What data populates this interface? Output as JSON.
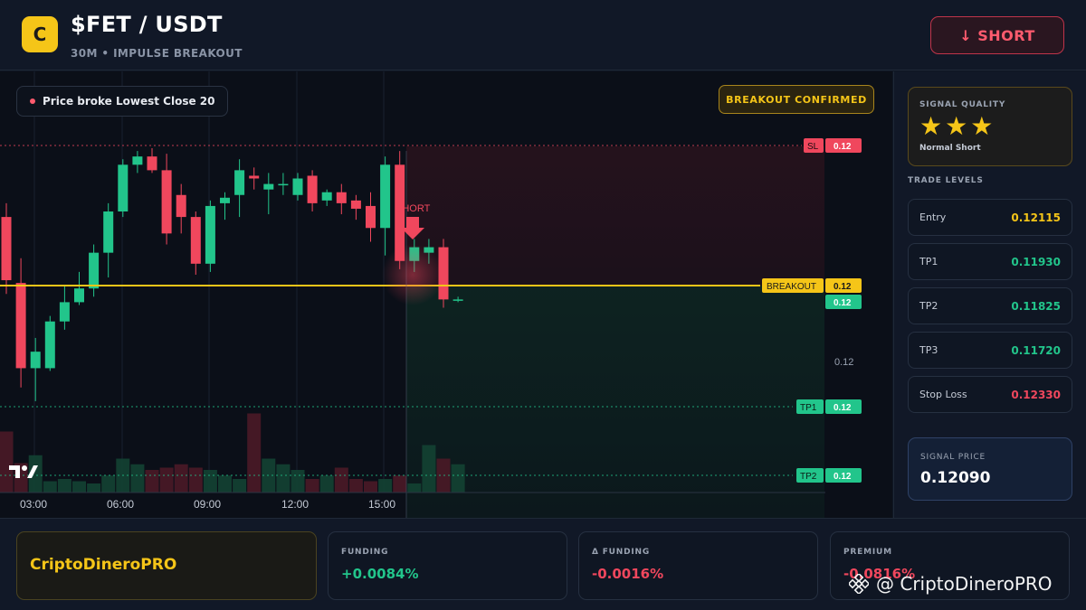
{
  "header": {
    "logo_letter": "C",
    "pair": "$FET / USDT",
    "subtitle": "30M • IMPULSE BREAKOUT",
    "action_label": "↓ SHORT"
  },
  "chart": {
    "info_text": "Price broke Lowest Close 20",
    "badge": "BREAKOUT CONFIRMED",
    "signal_label": "SHORT",
    "tv_logo": "TV",
    "colors": {
      "up": "#22c58b",
      "down": "#f0475d",
      "breakout": "#f5c518"
    }
  },
  "chart_data": {
    "type": "candlestick",
    "x_ticks": [
      "03:00",
      "06:00",
      "09:00",
      "12:00",
      "15:00"
    ],
    "price_ticks": [
      "0.12"
    ],
    "levels": [
      {
        "label": "SL",
        "value": "0.12"
      },
      {
        "label": "BREAKOUT",
        "value": "0.12"
      },
      {
        "label": "",
        "value": "0.12"
      },
      {
        "label": "TP1",
        "value": "0.12"
      },
      {
        "label": "TP2",
        "value": "0.12"
      }
    ],
    "candles": [
      {
        "o": 0.12148,
        "h": 0.12158,
        "l": 0.12092,
        "c": 0.12102
      },
      {
        "o": 0.121,
        "h": 0.12118,
        "l": 0.12024,
        "c": 0.12038
      },
      {
        "o": 0.12038,
        "h": 0.1206,
        "l": 0.12014,
        "c": 0.1205
      },
      {
        "o": 0.12038,
        "h": 0.12076,
        "l": 0.12036,
        "c": 0.12072
      },
      {
        "o": 0.12072,
        "h": 0.12098,
        "l": 0.12066,
        "c": 0.12086
      },
      {
        "o": 0.12086,
        "h": 0.12108,
        "l": 0.12084,
        "c": 0.12096
      },
      {
        "o": 0.12096,
        "h": 0.12128,
        "l": 0.1209,
        "c": 0.12122
      },
      {
        "o": 0.12122,
        "h": 0.12158,
        "l": 0.12104,
        "c": 0.12152
      },
      {
        "o": 0.12152,
        "h": 0.1219,
        "l": 0.12148,
        "c": 0.12186
      },
      {
        "o": 0.12186,
        "h": 0.12196,
        "l": 0.1218,
        "c": 0.12192
      },
      {
        "o": 0.12192,
        "h": 0.12198,
        "l": 0.1218,
        "c": 0.12182
      },
      {
        "o": 0.12182,
        "h": 0.12194,
        "l": 0.12128,
        "c": 0.12136
      },
      {
        "o": 0.12164,
        "h": 0.12172,
        "l": 0.12136,
        "c": 0.12148
      },
      {
        "o": 0.12148,
        "h": 0.12152,
        "l": 0.12106,
        "c": 0.12114
      },
      {
        "o": 0.12114,
        "h": 0.1216,
        "l": 0.12108,
        "c": 0.12156
      },
      {
        "o": 0.12158,
        "h": 0.12166,
        "l": 0.12146,
        "c": 0.12162
      },
      {
        "o": 0.12164,
        "h": 0.1219,
        "l": 0.12148,
        "c": 0.12182
      },
      {
        "o": 0.12178,
        "h": 0.12184,
        "l": 0.12168,
        "c": 0.12176
      },
      {
        "o": 0.12168,
        "h": 0.1218,
        "l": 0.1215,
        "c": 0.12172
      },
      {
        "o": 0.12172,
        "h": 0.1218,
        "l": 0.12164,
        "c": 0.12172
      },
      {
        "o": 0.12164,
        "h": 0.1218,
        "l": 0.1216,
        "c": 0.12176
      },
      {
        "o": 0.12178,
        "h": 0.12182,
        "l": 0.12152,
        "c": 0.12158
      },
      {
        "o": 0.1216,
        "h": 0.12168,
        "l": 0.12156,
        "c": 0.12166
      },
      {
        "o": 0.12166,
        "h": 0.12172,
        "l": 0.1215,
        "c": 0.12158
      },
      {
        "o": 0.1216,
        "h": 0.12164,
        "l": 0.12146,
        "c": 0.12154
      },
      {
        "o": 0.12156,
        "h": 0.12166,
        "l": 0.1213,
        "c": 0.1214
      },
      {
        "o": 0.1214,
        "h": 0.12192,
        "l": 0.1212,
        "c": 0.12186
      },
      {
        "o": 0.12186,
        "h": 0.12196,
        "l": 0.1211,
        "c": 0.12116
      },
      {
        "o": 0.12116,
        "h": 0.12132,
        "l": 0.12108,
        "c": 0.12126
      },
      {
        "o": 0.12122,
        "h": 0.12132,
        "l": 0.12114,
        "c": 0.12126
      },
      {
        "o": 0.12126,
        "h": 0.12132,
        "l": 0.12082,
        "c": 0.12088
      },
      {
        "o": 0.12088,
        "h": 0.1209,
        "l": 0.12086,
        "c": 0.12088
      }
    ],
    "volumes": [
      54,
      26,
      33,
      10,
      12,
      10,
      8,
      15,
      30,
      25,
      20,
      22,
      25,
      22,
      20,
      15,
      12,
      70,
      30,
      25,
      20,
      12,
      15,
      22,
      12,
      10,
      12,
      15,
      8,
      42,
      30,
      25
    ]
  },
  "panel": {
    "quality_label": "SIGNAL QUALITY",
    "stars": "★★★",
    "quality_desc": "Normal Short",
    "levels_title": "TRADE LEVELS",
    "levels": [
      {
        "name": "Entry",
        "value": "0.12115",
        "color": "#f5c518"
      },
      {
        "name": "TP1",
        "value": "0.11930",
        "color": "#22c58b"
      },
      {
        "name": "TP2",
        "value": "0.11825",
        "color": "#22c58b"
      },
      {
        "name": "TP3",
        "value": "0.11720",
        "color": "#22c58b"
      },
      {
        "name": "Stop Loss",
        "value": "0.12330",
        "color": "#f0475d"
      }
    ],
    "signal_price_label": "SIGNAL PRICE",
    "signal_price": "0.12090"
  },
  "footer": {
    "brand": "CriptoDineroPRO",
    "metrics": [
      {
        "label": "FUNDING",
        "value": "+0.0084%",
        "color": "#22c58b"
      },
      {
        "label": "Δ FUNDING",
        "value": "-0.0016%",
        "color": "#f0475d"
      },
      {
        "label": "PREMIUM",
        "value": "-0.0816%",
        "color": "#f0475d"
      }
    ],
    "watermark": "@ CriptoDineroPRO"
  }
}
